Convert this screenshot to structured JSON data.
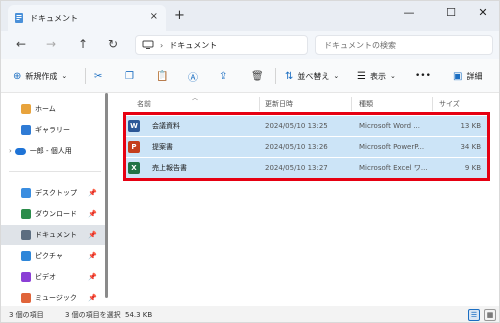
{
  "titlebar": {
    "tab_label": "ドキュメント",
    "tab_close": "×",
    "new_tab": "+",
    "minimize": "—",
    "maximize": "☐",
    "close": "✕"
  },
  "nav": {
    "back": "←",
    "forward": "→",
    "up": "↑",
    "refresh": "↻",
    "address_sep": "›",
    "address_location": "ドキュメント",
    "search_placeholder": "ドキュメントの検索"
  },
  "commandbar": {
    "new_label": "新規作成",
    "sort_label": "並べ替え",
    "view_label": "表示",
    "more_label": "•••",
    "details_label": "詳細"
  },
  "sidebar": {
    "items": [
      {
        "label": "ホーム",
        "icon": "home-icon",
        "color": "#e8a33c"
      },
      {
        "label": "ギャラリー",
        "icon": "gallery-icon",
        "color": "#2f7bd5"
      },
      {
        "label": "一郎 - 個人用",
        "icon": "onedrive-icon",
        "color": "#1e73d6"
      },
      {
        "label": "デスクトップ",
        "icon": "desktop-icon",
        "color": "#3a8de0"
      },
      {
        "label": "ダウンロード",
        "icon": "download-icon",
        "color": "#2a8c4a"
      },
      {
        "label": "ドキュメント",
        "icon": "documents-icon",
        "color": "#5c6d80"
      },
      {
        "label": "ピクチャ",
        "icon": "pictures-icon",
        "color": "#2e86d9"
      },
      {
        "label": "ビデオ",
        "icon": "videos-icon",
        "color": "#8b3fd6"
      },
      {
        "label": "ミュージック",
        "icon": "music-icon",
        "color": "#e0643a"
      }
    ],
    "pin": "📌"
  },
  "columns": {
    "name": "名前",
    "modified": "更新日時",
    "type": "種類",
    "size": "サイズ"
  },
  "files": [
    {
      "name": "会議資料",
      "modified": "2024/05/10 13:25",
      "type": "Microsoft Word ...",
      "size": "13 KB",
      "icon_letter": "W",
      "color": "#2b5797"
    },
    {
      "name": "提案書",
      "modified": "2024/05/10 13:26",
      "type": "Microsoft PowerP...",
      "size": "34 KB",
      "icon_letter": "P",
      "color": "#c43e1c"
    },
    {
      "name": "売上報告書",
      "modified": "2024/05/10 13:27",
      "type": "Microsoft Excel ワ...",
      "size": "9 KB",
      "icon_letter": "X",
      "color": "#217346"
    }
  ],
  "status": {
    "count": "3 個の項目",
    "selected": "3 個の項目を選択",
    "size": "54.3 KB"
  },
  "colors": {
    "selection": "#cce4f7",
    "highlight_border": "#e60012"
  }
}
